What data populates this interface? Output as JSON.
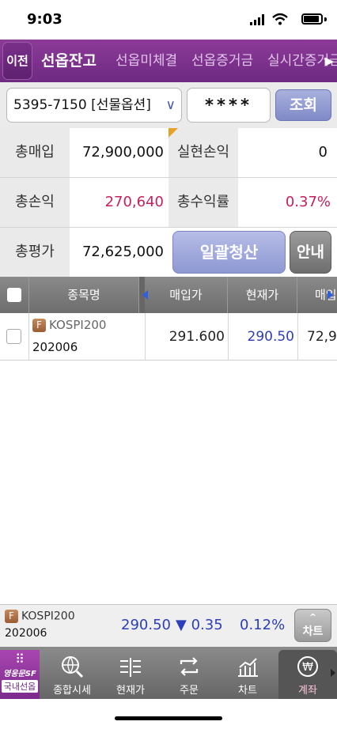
{
  "status": {
    "time": "9:03"
  },
  "header": {
    "back_label": "이전",
    "tabs": [
      {
        "label": "선옵잔고",
        "active": true
      },
      {
        "label": "선옵미체결",
        "active": false
      },
      {
        "label": "선옵증거금",
        "active": false
      },
      {
        "label": "실시간증거금",
        "active": false
      }
    ]
  },
  "account": {
    "selected": "5395-7150 [선물옵션]",
    "password_mask": "****",
    "query_label": "조회"
  },
  "summary": {
    "total_buy_label": "총매입",
    "total_buy": "72,900,000",
    "realized_label": "실현손익",
    "realized": "0",
    "total_pl_label": "총손익",
    "total_pl": "270,640",
    "total_rate_label": "총수익률",
    "total_rate": "0.37%",
    "total_eval_label": "총평가",
    "total_eval": "72,625,000",
    "liquidate_label": "일괄청산",
    "info_label": "안내"
  },
  "table": {
    "headers": [
      "종목명",
      "매입가",
      "현재가",
      "매입"
    ],
    "rows": [
      {
        "badge": "F",
        "name": "KOSPI200",
        "code": "202006",
        "buy_price": "291.600",
        "cur_price": "290.50",
        "buy_amount": "72,9"
      }
    ]
  },
  "quote": {
    "badge": "F",
    "name": "KOSPI200",
    "code": "202006",
    "price": "290.50",
    "change": "▼ 0.35",
    "rate": "0.12%",
    "chart_label": "차트",
    "chart_icon": "^"
  },
  "nav": {
    "home_glyph": "⠿",
    "home_title": "영웅문SF",
    "home_sub": "국내선옵",
    "items": [
      {
        "label": "종합시세",
        "icon": "globe-search-icon"
      },
      {
        "label": "현재가",
        "icon": "price-list-icon"
      },
      {
        "label": "주문",
        "icon": "exchange-arrows-icon"
      },
      {
        "label": "차트",
        "icon": "bar-chart-icon"
      },
      {
        "label": "계좌",
        "icon": "won-icon",
        "active": true
      }
    ]
  },
  "colors": {
    "header": "#7e3290",
    "profit": "#c8205a",
    "price": "#2c3eb8"
  }
}
